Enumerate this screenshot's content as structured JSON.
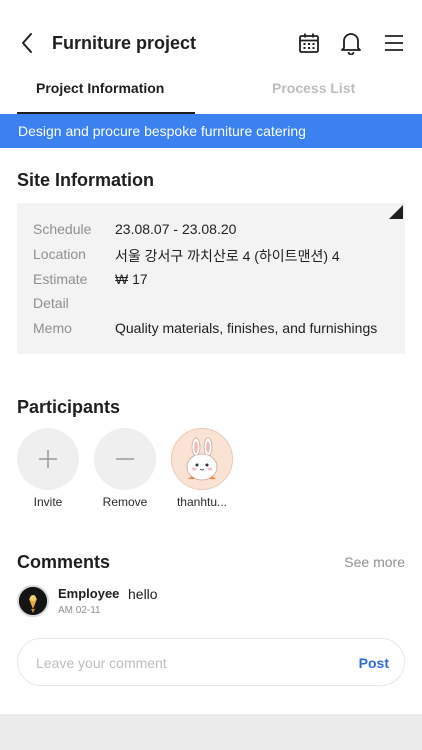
{
  "header": {
    "title": "Furniture project",
    "icons": [
      "back-chevron-icon",
      "calendar-icon",
      "bell-icon",
      "hamburger-menu-icon"
    ]
  },
  "tabs": [
    {
      "label": "Project Information",
      "active": true
    },
    {
      "label": "Process List",
      "active": false
    }
  ],
  "banner": {
    "text": "Design and procure bespoke furniture catering",
    "color": "#3b82f0"
  },
  "site_info": {
    "title": "Site Information",
    "rows": [
      {
        "label": "Schedule",
        "value": "23.08.07 - 23.08.20"
      },
      {
        "label": "Location",
        "value": "서울 강서구 까치산로 4 (하이트맨션) 4"
      },
      {
        "label": "Estimate",
        "value": "₩ 17"
      },
      {
        "label": "Detail",
        "value": ""
      },
      {
        "label": "Memo",
        "value": "Quality materials, finishes, and furnishings"
      }
    ]
  },
  "participants": {
    "title": "Participants",
    "items": [
      {
        "label": "Invite",
        "icon": "plus-icon"
      },
      {
        "label": "Remove",
        "icon": "minus-icon"
      },
      {
        "label": "thanhtu...",
        "icon": "bunny-avatar-icon"
      }
    ]
  },
  "comments": {
    "title": "Comments",
    "see_more": "See more",
    "items": [
      {
        "author": "Employee",
        "text": "hello",
        "time": "AM 02-11"
      }
    ],
    "input_placeholder": "Leave your comment",
    "post_label": "Post"
  },
  "colors": {
    "accent": "#3b82f0",
    "post": "#2f6bd8",
    "muted": "#8f8f8f"
  }
}
